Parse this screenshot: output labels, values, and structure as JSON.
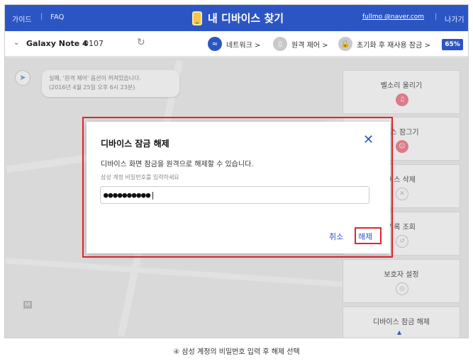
{
  "header": {
    "guide_label": "가이드",
    "faq_label": "FAQ",
    "title": "내 디바이스 찾기",
    "user_email": "fullmo        @naver.com",
    "exit_label": "나가기",
    "phone_icon": "phone-icon",
    "bg_color": "#2c55c4"
  },
  "toolbar": {
    "device_name": "Galaxy Note 4",
    "device_num": "0107",
    "network_label": "네트워크 >",
    "remote_label": "원격 제어 >",
    "reset_lock_label": "초기화 후 재사용 잠금 >",
    "battery": "65%"
  },
  "map": {
    "notice_line1": "실패, '원격 제어' 옵션이 꺼져있습니다.",
    "notice_line2": "(2016년 4월 25일 오후 6시 23분)",
    "metro_label": "M"
  },
  "side_panel": {
    "items": [
      {
        "label": "벨소리 울리기"
      },
      {
        "label": "이스 잠그기"
      },
      {
        "label": "이스 삭제"
      },
      {
        "label": "기록 조회"
      },
      {
        "label": "보호자 설정"
      },
      {
        "label": "디바이스 잠금 해제"
      }
    ]
  },
  "dialog": {
    "title": "디바이스 잠금 해제",
    "description": "디바이스 화면 잠금을 원격으로 해제할 수 있습니다.",
    "hint": "삼성 계정 비밀번호를 입력하세요",
    "password_value": "●●●●●●●●●●|",
    "cancel_label": "취소",
    "unlock_label": "해제",
    "highlight_color": "#e0262b",
    "accent_color": "#2c55c4"
  },
  "caption": "④ 삼성 계정의 비밀번호 입력 후 해제 선택"
}
